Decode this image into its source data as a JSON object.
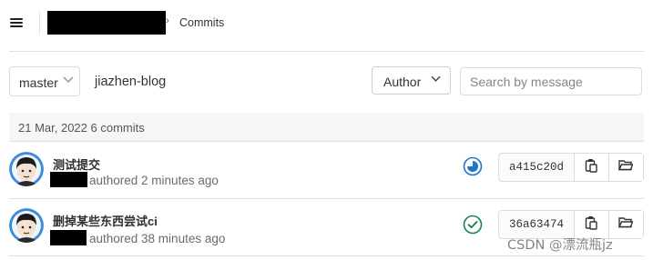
{
  "header": {
    "breadcrumb_current": "Commits",
    "breadcrumb_separator": "›"
  },
  "filters": {
    "branch": "master",
    "path": "jiazhen-blog",
    "author_button": "Author",
    "search_placeholder": "Search by message"
  },
  "day_group": {
    "label": "21 Mar, 2022 6 commits"
  },
  "commits": [
    {
      "title": "测试提交",
      "authored": "authored 2 minutes ago",
      "status": "running",
      "status_color": "#1f75cb",
      "sha": "a415c20d"
    },
    {
      "title": "删掉某些东西尝试ci",
      "authored": "authored 38 minutes ago",
      "status": "passed",
      "status_color": "#108548",
      "sha": "36a63474"
    }
  ],
  "icons": {
    "menu": "hamburger-icon",
    "copy": "clipboard-icon",
    "browse": "folder-open-icon"
  },
  "watermark": "CSDN @漂流瓶jz"
}
